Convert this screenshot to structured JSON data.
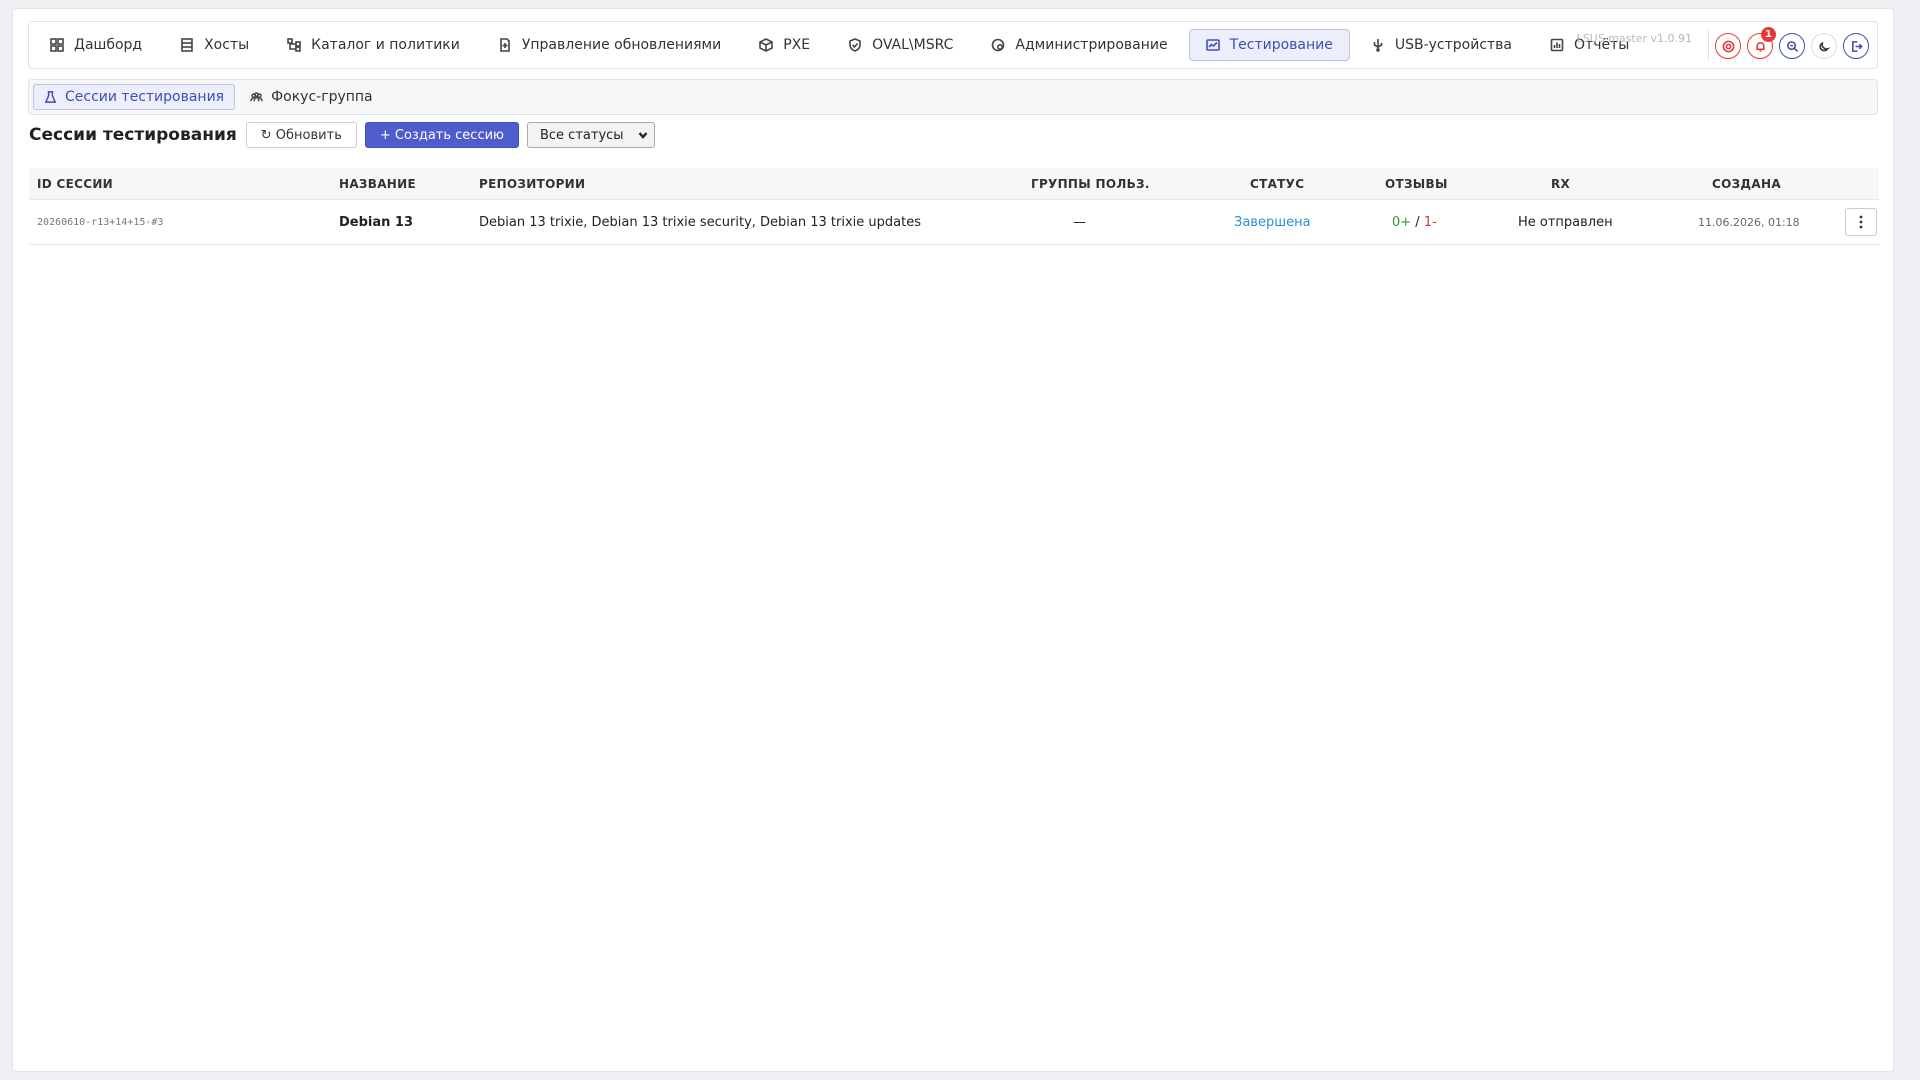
{
  "nav": {
    "items": [
      {
        "label": "Дашборд",
        "icon": "grid-icon"
      },
      {
        "label": "Хосты",
        "icon": "server-icon"
      },
      {
        "label": "Каталог и политики",
        "icon": "tree-icon"
      },
      {
        "label": "Управление обновлениями",
        "icon": "file-plus-icon"
      },
      {
        "label": "PXE",
        "icon": "box-icon"
      },
      {
        "label": "OVAL\\MSRC",
        "icon": "shield-icon"
      },
      {
        "label": "Администрирование",
        "icon": "settings-icon"
      },
      {
        "label": "Тестирование",
        "icon": "test-icon",
        "active": true
      },
      {
        "label": "USB-устройства",
        "icon": "usb-icon"
      },
      {
        "label": "Отчёты",
        "icon": "report-icon"
      }
    ],
    "version": "LSUS master v1.0.91",
    "notifications_count": "1"
  },
  "subnav": {
    "items": [
      {
        "label": "Сессии тестирования",
        "icon": "flask-icon",
        "active": true
      },
      {
        "label": "Фокус-группа",
        "icon": "users-icon"
      }
    ]
  },
  "toolbar": {
    "title": "Сессии тестирования",
    "refresh_label": "↻ Обновить",
    "create_label": "+ Создать сессию",
    "status_filter": "Все статусы"
  },
  "table": {
    "columns": [
      "ID СЕССИИ",
      "НАЗВАНИЕ",
      "РЕПОЗИТОРИИ",
      "ГРУППЫ ПОЛЬЗ.",
      "СТАТУС",
      "ОТЗЫВЫ",
      "RX",
      "СОЗДАНА"
    ],
    "rows": [
      {
        "id": "20260610-r13+14+15-#3",
        "name": "Debian 13",
        "repos": "Debian 13 trixie, Debian 13 trixie security, Debian 13 trixie updates",
        "groups": "—",
        "status": "Завершена",
        "feedback_pos": "0+",
        "feedback_sep": " / ",
        "feedback_neg": "1-",
        "rx": "Не отправлен",
        "created": "11.06.2026, 01:18"
      }
    ]
  },
  "colors": {
    "accent": "#4f5ccc",
    "active_bg": "#eceef9",
    "status_done": "#2a8fd4",
    "positive": "#2e9a3a",
    "negative": "#d23b3b"
  }
}
